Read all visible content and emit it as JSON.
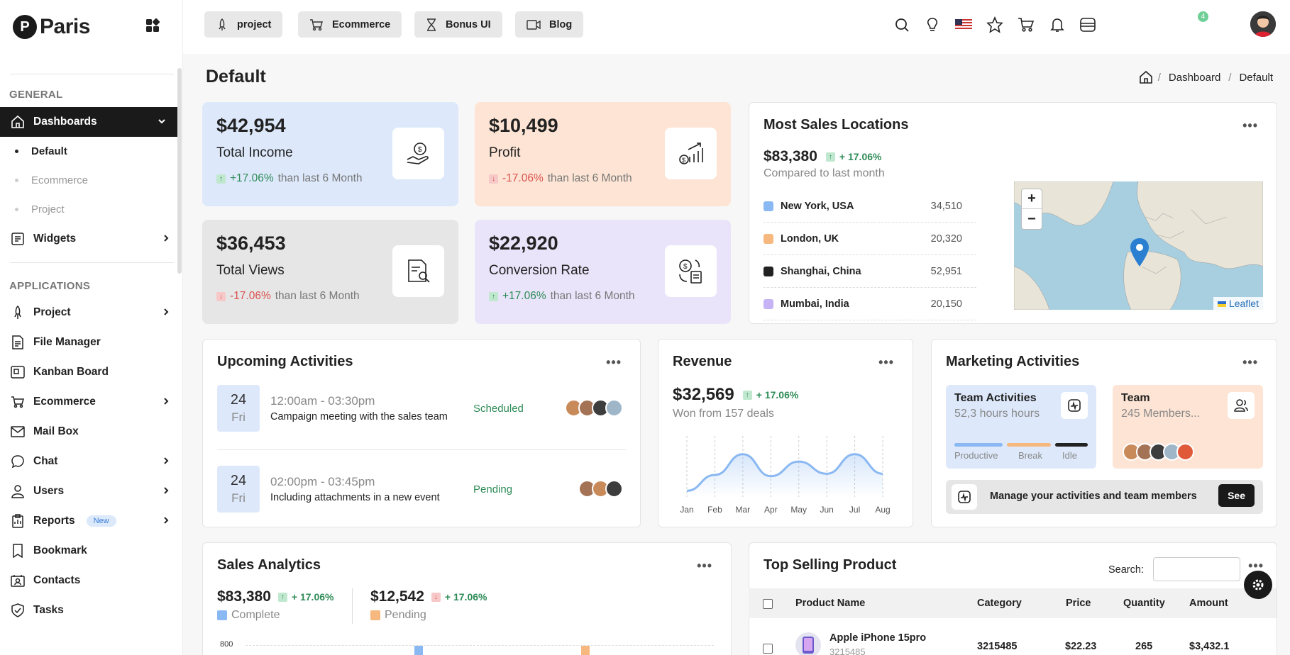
{
  "brand": {
    "name": "Paris",
    "mark": "P"
  },
  "sidebar": {
    "section_general": "GENERAL",
    "section_applications": "APPLICATIONS",
    "dashboards": "Dashboards",
    "sub": [
      "Default",
      "Ecommerce",
      "Project"
    ],
    "widgets": "Widgets",
    "items": [
      {
        "label": "Project",
        "chevron": true
      },
      {
        "label": "File Manager",
        "chevron": false
      },
      {
        "label": "Kanban Board",
        "chevron": false
      },
      {
        "label": "Ecommerce",
        "chevron": true
      },
      {
        "label": "Mail Box",
        "chevron": false
      },
      {
        "label": "Chat",
        "chevron": true
      },
      {
        "label": "Users",
        "chevron": true
      },
      {
        "label": "Reports",
        "chevron": true,
        "badge": "New"
      },
      {
        "label": "Bookmark",
        "chevron": false
      },
      {
        "label": "Contacts",
        "chevron": false
      },
      {
        "label": "Tasks",
        "chevron": false
      }
    ]
  },
  "header": {
    "buttons": [
      "project",
      "Ecommerce",
      "Bonus UI",
      "Blog"
    ],
    "notification_count": "4"
  },
  "page": {
    "title": "Default",
    "breadcrumb": [
      "Dashboard",
      "Default"
    ]
  },
  "stats": [
    {
      "value": "$42,954",
      "label": "Total Income",
      "pct": "+17.06%",
      "dir": "up",
      "suffix": "than last 6 Month",
      "bg": "#dde9fb"
    },
    {
      "value": "$10,499",
      "label": "Profit",
      "pct": "-17.06%",
      "dir": "down",
      "suffix": "than last 6 Month",
      "bg": "#fde4d4"
    },
    {
      "value": "$36,453",
      "label": "Total Views",
      "pct": "-17.06%",
      "dir": "down",
      "suffix": "than last 6 Month",
      "bg": "#e6e6e6"
    },
    {
      "value": "$22,920",
      "label": "Conversion Rate",
      "pct": "+17.06%",
      "dir": "up",
      "suffix": "than last 6 Month",
      "bg": "#e9e4fa"
    }
  ],
  "locations": {
    "title": "Most Sales Locations",
    "total": "$83,380",
    "pct": "+ 17.06%",
    "subtitle": "Compared to last month",
    "rows": [
      {
        "name": "New York, USA",
        "value": "34,510",
        "color": "#8ab8f2"
      },
      {
        "name": "London, UK",
        "value": "20,320",
        "color": "#f7b87f"
      },
      {
        "name": "Shanghai, China",
        "value": "52,951",
        "color": "#222222"
      },
      {
        "name": "Mumbai, India",
        "value": "20,150",
        "color": "#c5b3f5"
      }
    ],
    "map_attribution": "Leaflet",
    "zoom_in": "+",
    "zoom_out": "−"
  },
  "upcoming": {
    "title": "Upcoming Activities",
    "items": [
      {
        "day": "24",
        "weekday": "Fri",
        "time": "12:00am - 03:30pm",
        "desc": "Campaign meeting with the sales team",
        "status": "Scheduled"
      },
      {
        "day": "24",
        "weekday": "Fri",
        "time": "02:00pm - 03:45pm",
        "desc": "Including attachments in a new event",
        "status": "Pending"
      }
    ]
  },
  "revenue": {
    "title": "Revenue",
    "value": "$32,569",
    "pct": "+ 17.06%",
    "subtitle": "Won from 157 deals",
    "chart_data": {
      "type": "area",
      "x": [
        "Jan",
        "Feb",
        "Mar",
        "Apr",
        "May",
        "Jun",
        "Jul",
        "Aug"
      ],
      "y": [
        10,
        36,
        70,
        34,
        58,
        38,
        70,
        38
      ],
      "ylim": [
        0,
        100
      ]
    }
  },
  "marketing": {
    "title": "Marketing Activities",
    "team_activities": {
      "title": "Team Activities",
      "subtitle": "52,3 hours hours",
      "legend": [
        "Productive",
        "Break",
        "Idle"
      ]
    },
    "team": {
      "title": "Team",
      "subtitle": "245 Members..."
    },
    "manage": {
      "text": "Manage your activities and team members",
      "button": "See"
    }
  },
  "sales": {
    "title": "Sales Analytics",
    "a_value": "$83,380",
    "a_pct": "+ 17.06%",
    "a_label": "Complete",
    "b_value": "$12,542",
    "b_pct": "+ 17.06%",
    "b_label": "Pending",
    "y_tick": "800"
  },
  "top_selling": {
    "title": "Top Selling Product",
    "search_label": "Search:",
    "columns": [
      "Product Name",
      "Category",
      "Price",
      "Quantity",
      "Amount"
    ],
    "rows": [
      {
        "name": "Apple iPhone 15pro",
        "sub": "3215485",
        "category": "3215485",
        "price": "$22.23",
        "quantity": "265",
        "amount": "$3,432.1"
      }
    ]
  }
}
